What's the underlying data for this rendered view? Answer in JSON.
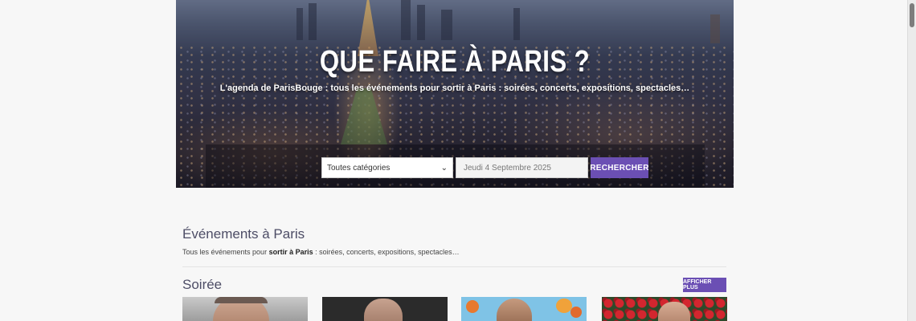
{
  "hero": {
    "title": "QUE FAIRE À PARIS ?",
    "subtitle": "L'agenda de ParisBouge : tous les événements pour sortir à Paris : soirées, concerts, expositions, spectacles…"
  },
  "search": {
    "category_value": "Toutes catégories",
    "date_value": "Jeudi 4 Septembre 2025",
    "button_label": "RECHERCHER"
  },
  "main": {
    "title": "Événements à Paris",
    "description_prefix": "Tous les événements pour ",
    "description_bold": "sortir à Paris",
    "description_suffix": " : soirées, concerts, expositions, spectacles…"
  },
  "category": {
    "title": "Soirée",
    "show_more_label": "AFFICHER PLUS"
  },
  "colors": {
    "accent": "#6b4fb4",
    "background": "#f7f7f7"
  }
}
